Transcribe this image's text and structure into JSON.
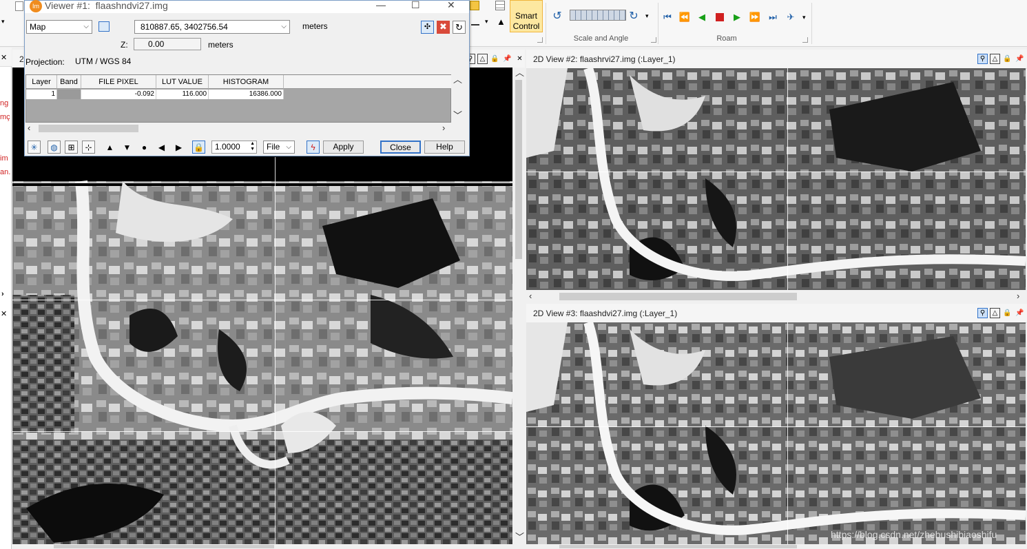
{
  "ribbon": {
    "smart_control_line1": "Smart",
    "smart_control_line2": "Control",
    "group_scale_angle": "Scale and Angle",
    "group_roam": "Roam"
  },
  "dialog": {
    "title": "Viewer #1:  flaashndvi27.img",
    "app_badge": "Im",
    "coord_type": "Map",
    "coordinates": "810887.65,  3402756.54",
    "units": "meters",
    "z_label": "Z:",
    "z_value": "0.00",
    "z_units": "meters",
    "projection_label": "Projection:",
    "projection_value": "UTM / WGS 84",
    "table": {
      "columns": [
        "Layer",
        "Band",
        "FILE PIXEL",
        "LUT VALUE",
        "HISTOGRAM"
      ],
      "row": {
        "layer": "1",
        "band": "",
        "file_pixel": "-0.092",
        "lut_value": "116.000",
        "histogram": "16386.000"
      }
    },
    "scale_value": "1.0000",
    "file_menu": "File",
    "apply": "Apply",
    "close": "Close",
    "help": "Help"
  },
  "views": {
    "view1_tab": "2",
    "view2_title": "2D View #2: flaashrvi27.img (:Layer_1)",
    "view3_title": "2D View #3: flaashdvi27.img (:Layer_1)"
  },
  "left_strip": [
    "ng",
    "mç",
    "im",
    "an."
  ],
  "watermark": "https://blog.csdn.net/zhebushibiaoshifu",
  "colors": {
    "accent": "#3272c8",
    "smart_fill": "#fde8a0",
    "red_text": "#d02020"
  }
}
